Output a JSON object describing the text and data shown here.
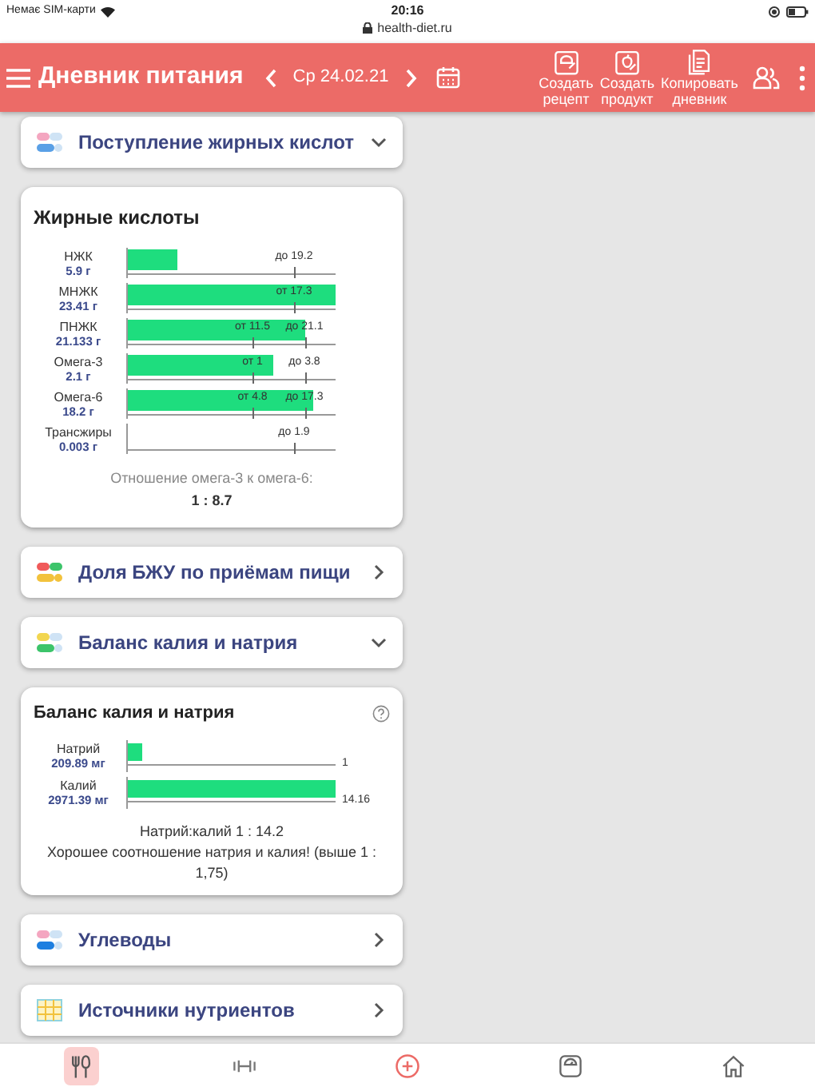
{
  "status_bar": {
    "carrier": "Немає SIM-карти",
    "time": "20:16",
    "url": "health-diet.ru"
  },
  "header": {
    "title": "Дневник питания",
    "date": "Ср 24.02.21",
    "actions": [
      {
        "line1": "Создать",
        "line2": "рецепт"
      },
      {
        "line1": "Создать",
        "line2": "продукт"
      },
      {
        "line1": "Копировать",
        "line2": "дневник"
      }
    ]
  },
  "sections": [
    {
      "kind": "header",
      "title": "Поступление жирных кислот",
      "expanded": true
    },
    {
      "kind": "fat_card",
      "title": "Жирные кислоты",
      "rows": [
        {
          "name": "НЖК",
          "amount": "5.9 г",
          "level": 0.24,
          "markers": [
            {
              "label": "до 19.2",
              "level": 0.8
            }
          ]
        },
        {
          "name": "МНЖК",
          "amount": "23.41 г",
          "level": 1,
          "markers": [
            {
              "label": "от 17.3",
              "level": 0.8
            }
          ]
        },
        {
          "name": "ПНЖК",
          "amount": "21.133 г",
          "level": 0.85,
          "markers": [
            {
              "label": "от 11.5",
              "level": 0.6
            },
            {
              "label": "до 21.1",
              "level": 0.85
            }
          ]
        },
        {
          "name": "Омега-3",
          "amount": "2.1 г",
          "level": 0.7,
          "markers": [
            {
              "label": "от 1",
              "level": 0.6
            },
            {
              "label": "до 3.8",
              "level": 0.85
            }
          ]
        },
        {
          "name": "Омега-6",
          "amount": "18.2 г",
          "level": 0.89,
          "markers": [
            {
              "label": "от 4.8",
              "level": 0.6
            },
            {
              "label": "до 17.3",
              "level": 0.85
            }
          ]
        },
        {
          "name": "Трансжиры",
          "amount": "0.003 г",
          "markers": [
            {
              "label": "до 1.9",
              "level": 0.8
            }
          ]
        }
      ],
      "ratio_label": "Отношение омега-3 к омега-6:",
      "ratio_value": "1 : 8.7"
    },
    {
      "kind": "header",
      "title": "Доля БЖУ по приёмам пищи",
      "expanded": false
    },
    {
      "kind": "header",
      "title": "Баланс калия и натрия",
      "expanded": true
    },
    {
      "kind": "mineral_card",
      "title": "Баланс калия и натрия",
      "rows": [
        {
          "name": "Натрий",
          "amount": "209.89 мг",
          "level": 0.07,
          "value": "1"
        },
        {
          "name": "Калий",
          "amount": "2971.39 мг",
          "level": 1,
          "value": "14.16"
        }
      ],
      "ratio": "Натрий:калий 1 : 14.2",
      "note": "Хорошее соотношение натрия и калия! (выше 1 : 1,75)"
    },
    {
      "kind": "header",
      "title": "Углеводы",
      "expanded": false
    },
    {
      "kind": "header",
      "title": "Источники нутриентов",
      "expanded": false
    }
  ],
  "bottom_nav": [
    {
      "selected": true
    },
    {
      "selected": false
    },
    {
      "selected": false
    },
    {
      "selected": false
    },
    {
      "selected": false
    }
  ]
}
